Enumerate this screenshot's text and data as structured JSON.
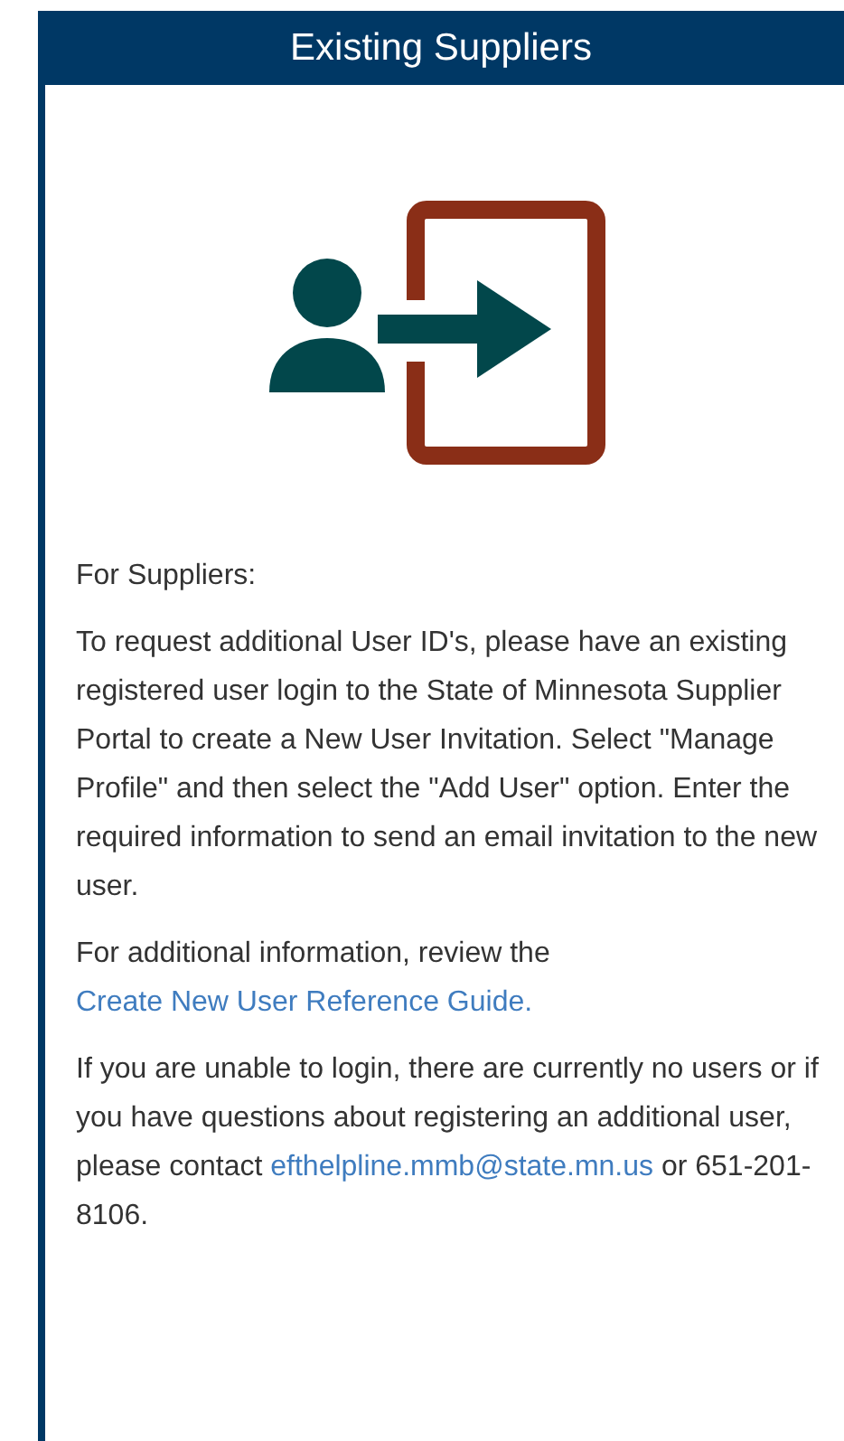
{
  "header": {
    "title": "Existing Suppliers"
  },
  "content": {
    "intro": "For Suppliers:",
    "paragraphs": [
      [
        {
          "kind": "text",
          "text": "To request additional User ID's, please have an existing registered user login to the State of Minnesota Supplier Portal to create a New User Invitation. Select \"Manage Profile\" and then select the \"Add User\" option. Enter the required information to send an email invitation to the new user."
        }
      ],
      [
        {
          "kind": "text",
          "text": "For additional information, review the "
        },
        {
          "kind": "link",
          "text": "Create New User Reference Guide."
        }
      ],
      [
        {
          "kind": "text",
          "text": "If you are unable to login, there are currently no users or if you have questions about registering an additional user, please contact "
        },
        {
          "kind": "link",
          "text": "efthelpline.mmb@state.mn.us"
        },
        {
          "kind": "text",
          "text": " or 651-201-8106."
        }
      ]
    ]
  }
}
